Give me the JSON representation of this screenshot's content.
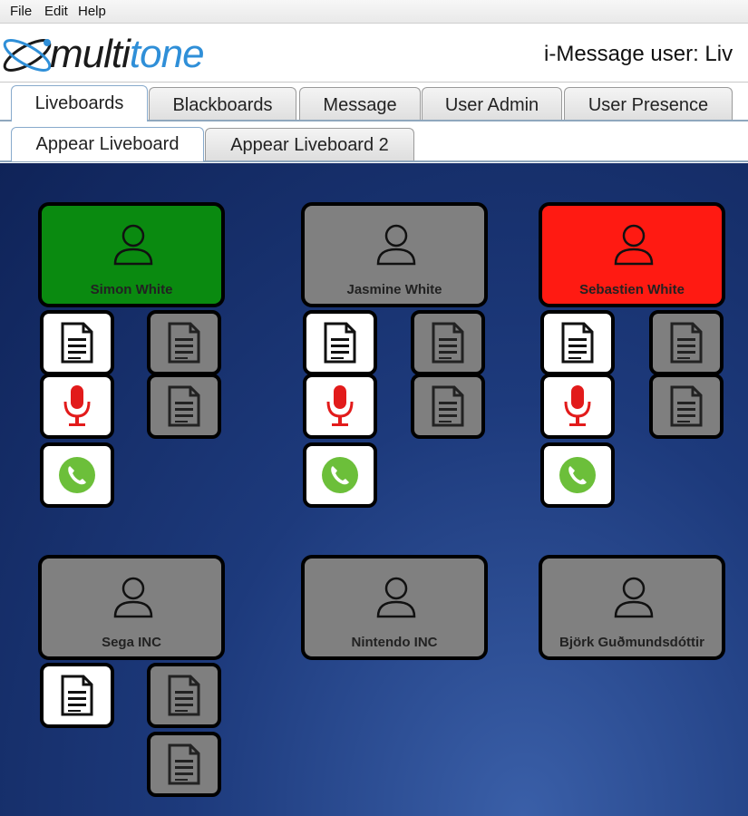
{
  "menu": {
    "file": "File",
    "edit": "Edit",
    "help": "Help"
  },
  "header": {
    "logo_prefix": "multi",
    "logo_suffix": "tone",
    "user_label": "i-Message user: Liv"
  },
  "tabs": [
    "Liveboards",
    "Blackboards",
    "Message",
    "User Admin",
    "User Presence"
  ],
  "subtabs": [
    "Appear Liveboard",
    "Appear Liveboard 2"
  ],
  "cards": [
    {
      "name": "Simon White",
      "status_color": "#0a8a10"
    },
    {
      "name": "Jasmine White",
      "status_color": "#808080"
    },
    {
      "name": "Sebastien White",
      "status_color": "#ff1a12"
    },
    {
      "name": "Sega INC",
      "status_color": "#808080"
    },
    {
      "name": "Nintendo INC",
      "status_color": "#808080"
    },
    {
      "name": "Björk Guðmundsdóttir",
      "status_color": "#808080"
    }
  ],
  "icons": {
    "document": "document-icon",
    "microphone": "microphone-icon",
    "phone": "phone-icon",
    "person": "person-icon"
  },
  "colors": {
    "board_bg": "#1d3a7c",
    "accent": "#2f8fd8",
    "mic": "#e21b1b",
    "phone": "#6cbf3a"
  }
}
